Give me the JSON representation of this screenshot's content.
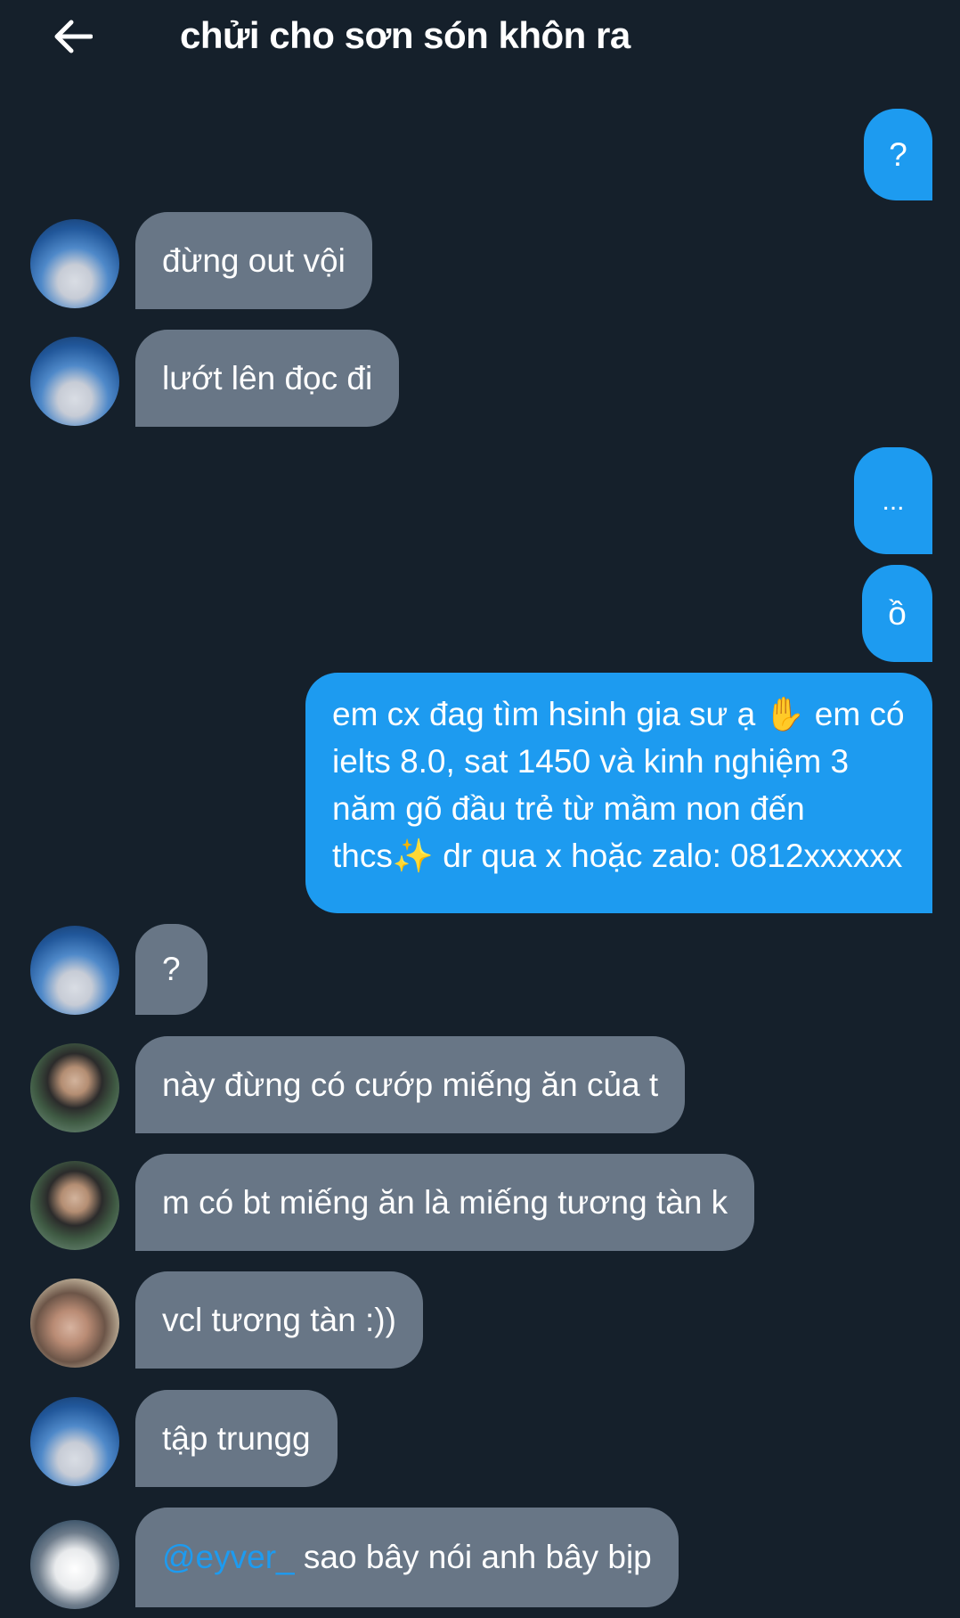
{
  "header": {
    "title": "chửi cho sơn són khôn ra"
  },
  "messages": [
    {
      "side": "out",
      "text": "?"
    },
    {
      "side": "in",
      "avatar": "sky",
      "text": "đừng out vội"
    },
    {
      "side": "in",
      "avatar": "sky",
      "text": "lướt lên đọc đi"
    },
    {
      "side": "out",
      "text": "..."
    },
    {
      "side": "out",
      "text": "ồ"
    },
    {
      "side": "out",
      "lines": [
        "em cx đag tìm hsinh gia sư ạ ✋ em có",
        "ielts 8.0, sat 1450 và kinh nghiệm 3",
        "năm gõ đầu trẻ từ mầm non đến",
        "thcs✨ dr qua x hoặc zalo: 0812xxxxxx"
      ]
    },
    {
      "side": "in",
      "avatar": "sky",
      "text": "?"
    },
    {
      "side": "in",
      "avatar": "outdoor",
      "text": "này đừng có cướp miếng ăn của t"
    },
    {
      "side": "in",
      "avatar": "outdoor",
      "text": "m có bt miếng ăn là miếng tương tàn k"
    },
    {
      "side": "in",
      "avatar": "warm",
      "text": "vcl tương tàn :))"
    },
    {
      "side": "in",
      "avatar": "sky",
      "text": "tập trungg"
    },
    {
      "side": "in",
      "avatar": "light",
      "mention": "@eyver_",
      "text": " sao bây nói anh bây bịp"
    }
  ]
}
